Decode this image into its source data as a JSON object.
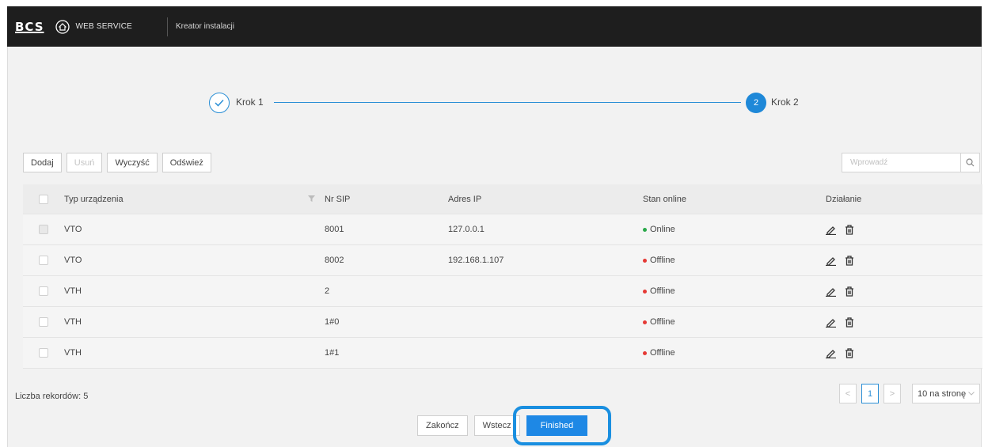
{
  "header": {
    "logo_text": "BCS",
    "brand_title": "WEB SERVICE",
    "breadcrumb": "Kreator instalacji"
  },
  "steps": {
    "step1": "Krok 1",
    "step2": "Krok 2",
    "step2_number": "2"
  },
  "toolbar": {
    "add": "Dodaj",
    "delete": "Usuń",
    "clear": "Wyczyść",
    "refresh": "Odśwież"
  },
  "search": {
    "placeholder": "Wprowadź"
  },
  "table": {
    "columns": {
      "type": "Typ urządzenia",
      "sip": "Nr SIP",
      "ip": "Adres IP",
      "status": "Stan online",
      "action": "Działanie"
    },
    "rows": [
      {
        "type": "VTO",
        "sip": "8001",
        "ip": "127.0.0.1",
        "status": "Online",
        "status_color": "#2aa84a"
      },
      {
        "type": "VTO",
        "sip": "8002",
        "ip": "192.168.1.107",
        "status": "Offline",
        "status_color": "#e53935"
      },
      {
        "type": "VTH",
        "sip": "2",
        "ip": "",
        "status": "Offline",
        "status_color": "#e53935"
      },
      {
        "type": "VTH",
        "sip": "1#0",
        "ip": "",
        "status": "Offline",
        "status_color": "#e53935"
      },
      {
        "type": "VTH",
        "sip": "1#1",
        "ip": "",
        "status": "Offline",
        "status_color": "#e53935"
      }
    ]
  },
  "footer": {
    "record_count": "Liczba rekordów: 5",
    "page_prev": "<",
    "page_current": "1",
    "page_next": ">",
    "page_size": "10 na stronę"
  },
  "actions": {
    "finish": "Zakończ",
    "back": "Wstecz",
    "finished": "Finished"
  },
  "colors": {
    "accent": "#1e88e5",
    "online": "#2aa84a",
    "offline": "#e53935"
  }
}
